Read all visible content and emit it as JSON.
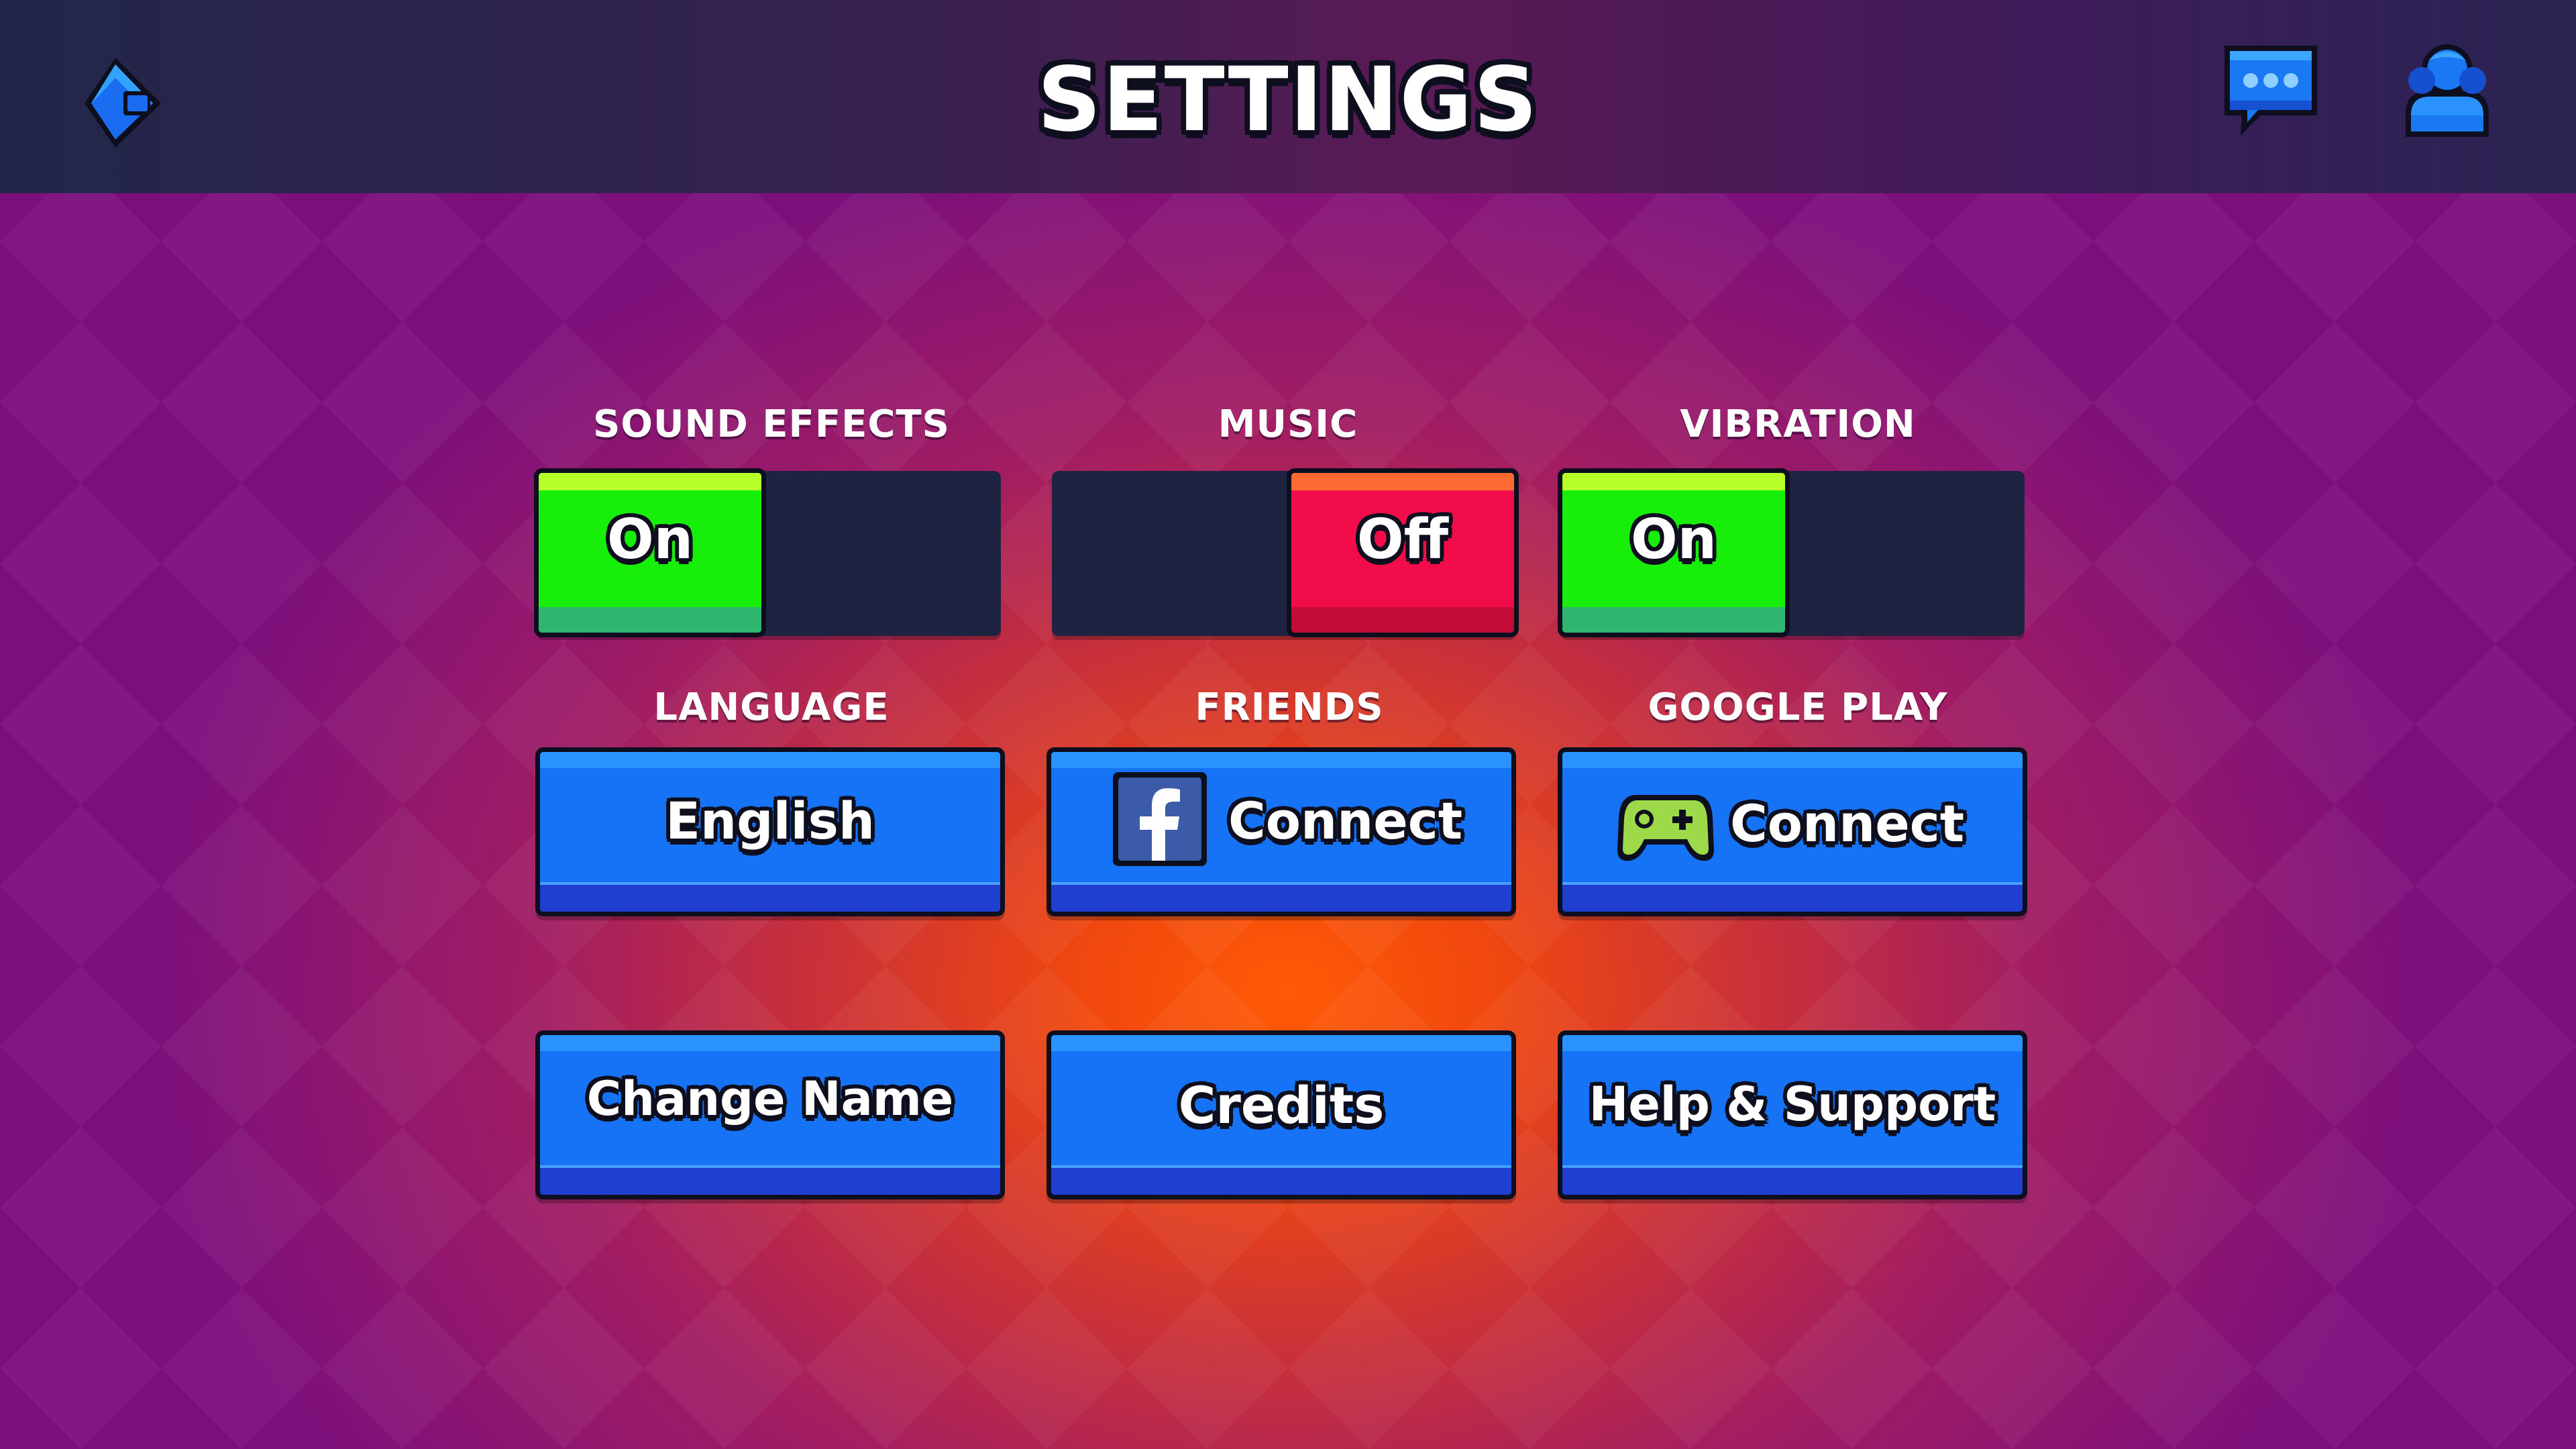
{
  "header": {
    "title": "SETTINGS",
    "back_icon": "back-arrow-icon",
    "chat_icon": "chat-bubble-icon",
    "profile_icon": "friends-icon"
  },
  "settings": {
    "sound_effects": {
      "label": "SOUND EFFECTS",
      "state": "On",
      "enabled": true
    },
    "music": {
      "label": "MUSIC",
      "state": "Off",
      "enabled": false
    },
    "vibration": {
      "label": "VIBRATION",
      "state": "On",
      "enabled": true
    }
  },
  "options": {
    "language": {
      "label": "LANGUAGE",
      "button": "English"
    },
    "friends": {
      "label": "FRIENDS",
      "button": "Connect",
      "icon": "facebook-icon"
    },
    "google_play": {
      "label": "GOOGLE PLAY",
      "button": "Connect",
      "icon": "gamepad-icon"
    }
  },
  "actions": {
    "change_name": "Change Name",
    "credits": "Credits",
    "help_support": "Help & Support"
  },
  "colors": {
    "on": "#17ef0a",
    "off": "#f20d4a",
    "button_blue": "#1773f5",
    "outline": "#0d0f1e",
    "topbar": "#222649"
  }
}
